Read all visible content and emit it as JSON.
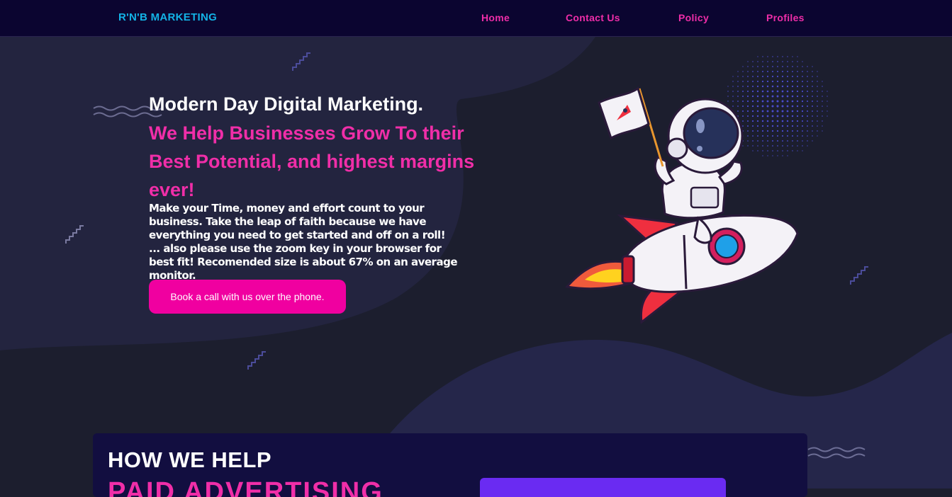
{
  "nav": {
    "brand": "R'N'B MARKETING",
    "links": [
      "Home",
      "Contact Us",
      "Policy",
      "Profiles"
    ]
  },
  "hero": {
    "title": "Modern Day Digital Marketing.",
    "subtitle": "We Help Businesses Grow To their Best Potential, and highest margins ever!",
    "body_lines": [
      "Make your Time, money and effort count to your business. Take the leap of faith because we have everything you need to get started and off on a roll!",
      "... also please use the zoom key in your browser for best fit! Recomended size is about 67% on an average monitor."
    ],
    "cta_label": "Book a call with us over the phone.",
    "flag_icon": "rocket-icon"
  },
  "how": {
    "title": "HOW WE HELP",
    "subtitle": "PAID ADVERTISING"
  },
  "colors": {
    "nav_bg": "#0b0530",
    "page_bg": "#1c1e2e",
    "brand": "#13b3e6",
    "accent_pink": "#f02ea8",
    "cta_bg": "#f000a0",
    "card_bg": "#120e40",
    "panel_purple": "#6a2bf2"
  }
}
